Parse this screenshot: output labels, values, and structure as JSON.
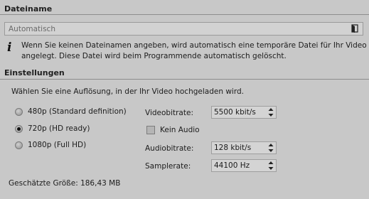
{
  "filename_section": {
    "title": "Dateiname",
    "input_value": "Automatisch",
    "info_text_line1": "Wenn Sie keinen Dateinamen angeben, wird automatisch eine temporäre Datei für Ihr Video",
    "info_text_line2": "angelegt. Diese Datei wird beim Programmende automatisch gelöscht."
  },
  "settings_section": {
    "title": "Einstellungen",
    "instruction": "Wählen Sie eine Auflösung, in der Ihr Video hochgeladen wird.",
    "resolutions": [
      {
        "label": "480p (Standard definition)",
        "selected": false
      },
      {
        "label": "720p (HD ready)",
        "selected": true
      },
      {
        "label": "1080p (Full HD)",
        "selected": false
      }
    ],
    "video_bitrate_label": "Videobitrate:",
    "video_bitrate_value": "5500 kbit/s",
    "no_audio_label": "Kein Audio",
    "no_audio_checked": false,
    "audio_bitrate_label": "Audiobitrate:",
    "audio_bitrate_value": "128 kbit/s",
    "samplerate_label": "Samplerate:",
    "samplerate_value": "44100 Hz",
    "estimated_size": "Geschätzte Größe: 186,43 MB"
  },
  "icons": {
    "folder": "folder-icon",
    "info": "info-icon",
    "spinner": "spinner-arrows-icon"
  }
}
